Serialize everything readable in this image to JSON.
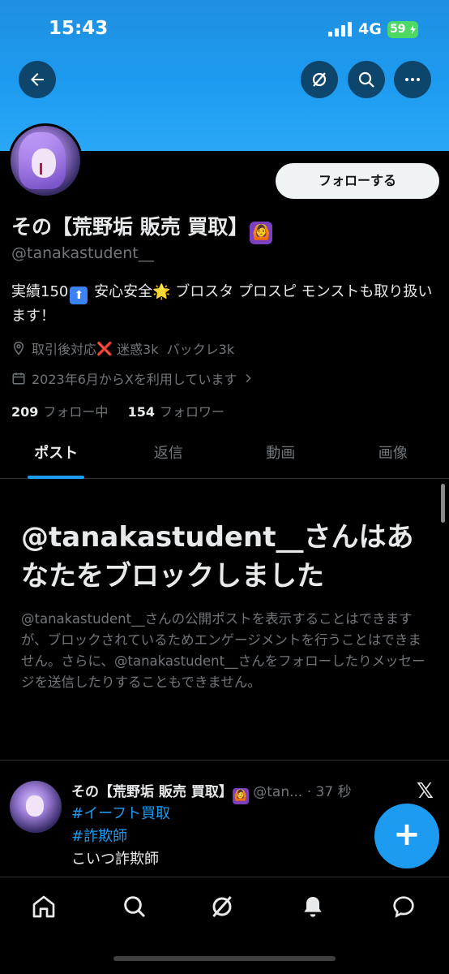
{
  "status_bar": {
    "time": "15:43",
    "network": "4G",
    "battery": "59"
  },
  "header": {
    "back_icon": "arrow-left-icon",
    "grok_icon": "grok-slash-icon",
    "search_icon": "search-icon",
    "more_icon": "more-horizontal-icon",
    "banner_color": "#1d9bf0"
  },
  "profile": {
    "display_name": "その【荒野垢 販売 買取】",
    "display_emoji": "🙆",
    "handle": "@tanakastudent__",
    "follow_label": "フォローする",
    "bio": {
      "prefix": "実績150",
      "badge": "⬆",
      "middle": " 安心安全",
      "star": "🌟",
      "suffix": " ブロスタ プロスピ モンストも取り扱います！"
    },
    "location": {
      "text_before": "取引後対応",
      "x_mark": "❌",
      "text_after": " 迷惑3k  バックレ3k"
    },
    "joined": "2023年6月からXを利用しています",
    "following_count": "209",
    "following_label": "フォロー中",
    "followers_count": "154",
    "followers_label": "フォロワー"
  },
  "tabs": [
    {
      "label": "ポスト",
      "active": true
    },
    {
      "label": "返信",
      "active": false
    },
    {
      "label": "動画",
      "active": false
    },
    {
      "label": "画像",
      "active": false
    }
  ],
  "blocked": {
    "title": "@tanakastudent__さんはあなたをブロックしました",
    "body": "@tanakastudent__さんの公開ポストを表示することはできますが、ブロックされているためエンゲージメントを行うことはできません。さらに、@tanakastudent__さんをフォローしたりメッセージを送信したりすることもできません。"
  },
  "tweet": {
    "name": "その【荒野垢 販売 買取】",
    "emoji": "🙆",
    "handle": "@tan...",
    "time": "· 37 秒",
    "hashtag1": "#イーフト買取",
    "hashtag2": "#詐欺師",
    "text": "こいつ詐欺師",
    "x_logo": "𝕏"
  },
  "fab_label": "+",
  "nav": [
    "home-icon",
    "search-icon",
    "grok-icon",
    "notifications-icon",
    "messages-icon"
  ]
}
